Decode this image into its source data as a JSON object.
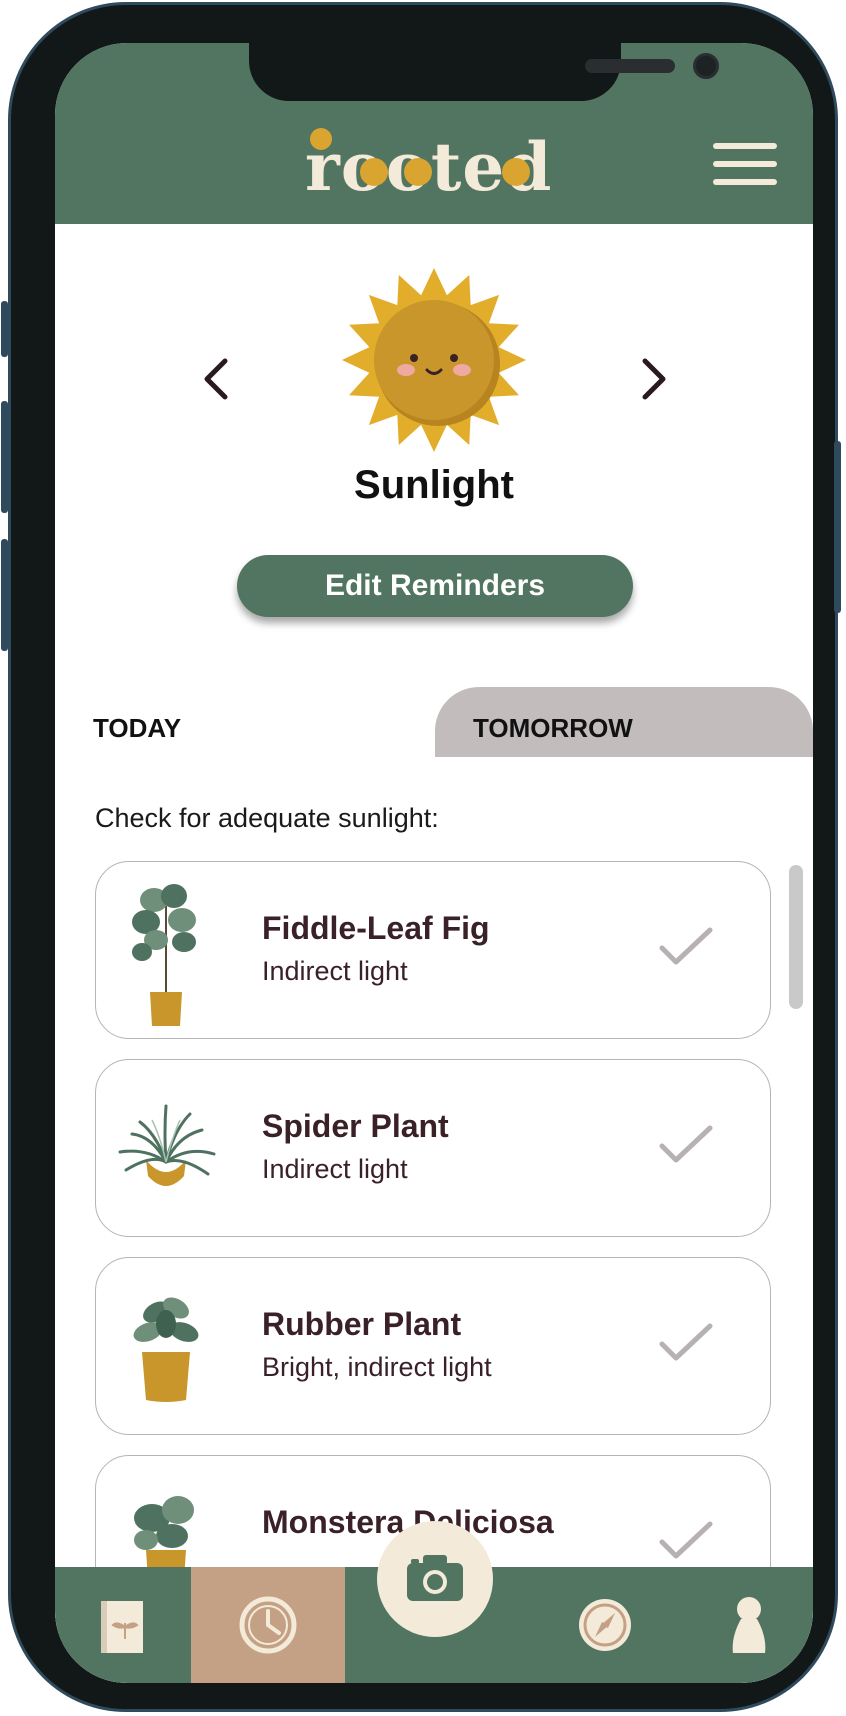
{
  "app": {
    "logo_text": "rooted",
    "brand_color": "#517560",
    "accent_color": "#d9a430",
    "menu_icon": "hamburger-menu-icon"
  },
  "hero": {
    "title": "Sunlight",
    "icon": "sun-icon",
    "prev_icon": "chevron-left-icon",
    "next_icon": "chevron-right-icon",
    "edit_button_label": "Edit Reminders"
  },
  "tabs": [
    {
      "label": "TODAY",
      "active": true
    },
    {
      "label": "TOMORROW",
      "active": false
    }
  ],
  "prompt": "Check for adequate sunlight:",
  "plants": [
    {
      "name": "Fiddle-Leaf Fig",
      "light": "Indirect light",
      "icon": "fiddle-leaf-fig-icon"
    },
    {
      "name": "Spider Plant",
      "light": "Indirect light",
      "icon": "spider-plant-icon"
    },
    {
      "name": "Rubber Plant",
      "light": "Bright, indirect light",
      "icon": "rubber-plant-icon"
    },
    {
      "name": "Monstera Deliciosa",
      "light": "",
      "icon": "monstera-icon"
    }
  ],
  "nav": [
    {
      "icon": "journal-icon",
      "active": false
    },
    {
      "icon": "clock-icon",
      "active": true
    },
    {
      "icon": "camera-icon",
      "active": false
    },
    {
      "icon": "compass-icon",
      "active": false
    },
    {
      "icon": "profile-icon",
      "active": false
    }
  ]
}
